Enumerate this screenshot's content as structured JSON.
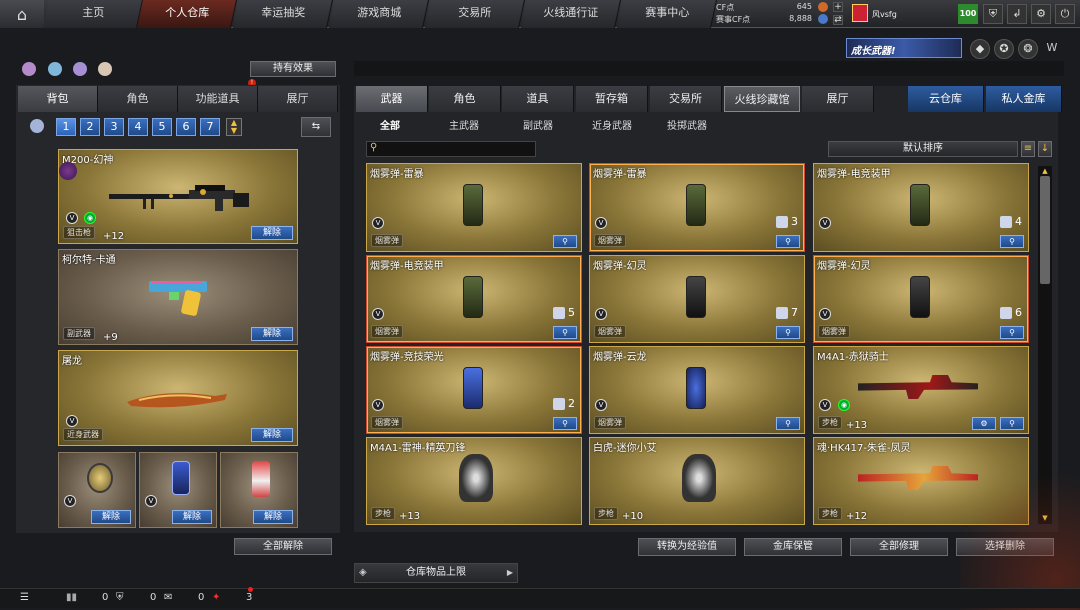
{
  "nav": {
    "tabs": [
      "主页",
      "个人仓库",
      "幸运抽奖",
      "游戏商城",
      "交易所",
      "火线通行证",
      "赛事中心"
    ],
    "active_index": 1
  },
  "currency": {
    "cf_label": "CF点",
    "cf_value": "645",
    "match_cf_label": "赛事CF点",
    "match_cf_value": "8,888"
  },
  "user": {
    "name": "风vsfg",
    "level": "100"
  },
  "banner": {
    "text": "成长武器!"
  },
  "left": {
    "effects_button": "持有效果",
    "tabs": [
      "背包",
      "角色",
      "功能道具",
      "展厅"
    ],
    "pages": [
      "1",
      "2",
      "3",
      "4",
      "5",
      "6",
      "7"
    ],
    "unequip_all": "全部解除",
    "slots": [
      {
        "name": "M200-幻神",
        "tag": "狙击枪",
        "plus": "+12",
        "remove": "解除"
      },
      {
        "name": "柯尔特-卡通",
        "tag": "副武器",
        "plus": "+9",
        "remove": "解除"
      },
      {
        "name": "屠龙",
        "tag": "近身武器",
        "plus": "",
        "remove": "解除"
      }
    ],
    "small_slots": [
      {
        "remove": "解除"
      },
      {
        "remove": "解除"
      },
      {
        "remove": "解除"
      }
    ]
  },
  "right": {
    "tabs": [
      "武器",
      "角色",
      "道具",
      "暂存箱",
      "交易所",
      "火线珍藏馆",
      "展厅"
    ],
    "storage_tabs": [
      "云仓库",
      "私人金库"
    ],
    "subtabs": [
      "全部",
      "主武器",
      "副武器",
      "近身武器",
      "投掷武器"
    ],
    "sort_label": "默认排序",
    "items": [
      {
        "name": "烟雾弹-雷暴",
        "tag": "烟雾弹",
        "count": ""
      },
      {
        "name": "烟雾弹-雷暴",
        "tag": "烟雾弹",
        "count": "3"
      },
      {
        "name": "烟雾弹-电竞装甲",
        "tag": "",
        "count": "4"
      },
      {
        "name": "烟雾弹-电竞装甲",
        "tag": "烟雾弹",
        "count": "5"
      },
      {
        "name": "烟雾弹-幻灵",
        "tag": "烟雾弹",
        "count": "7"
      },
      {
        "name": "烟雾弹-幻灵",
        "tag": "烟雾弹",
        "count": "6"
      },
      {
        "name": "烟雾弹-竞技荣光",
        "tag": "烟雾弹",
        "count": "2"
      },
      {
        "name": "烟雾弹-云龙",
        "tag": "烟雾弹",
        "count": ""
      },
      {
        "name": "M4A1-赤狱骑士",
        "tag": "步枪",
        "count": "",
        "plus": "+13"
      },
      {
        "name": "M4A1-雷神-精英刀锋",
        "tag": "步枪",
        "count": "",
        "plus": "+13"
      },
      {
        "name": "白虎-迷你小艾",
        "tag": "步枪",
        "count": "",
        "plus": "+10"
      },
      {
        "name": "魂·HK417-朱雀-凤灵",
        "tag": "步枪",
        "count": "",
        "plus": "+12"
      }
    ],
    "actions": [
      "转换为经验值",
      "金库保管",
      "全部修理",
      "选择删除"
    ],
    "capacity_label": "仓库物品上限"
  },
  "footer": {
    "counts": [
      "0",
      "0",
      "0",
      "3"
    ]
  }
}
